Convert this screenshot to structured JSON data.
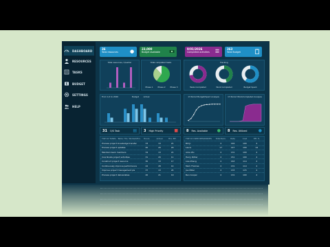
{
  "sidebar": {
    "items": [
      {
        "label": "DASHBOARD",
        "icon": "gauge-icon"
      },
      {
        "label": "RESOURCES",
        "icon": "user-icon"
      },
      {
        "label": "TASKS",
        "icon": "list-icon"
      },
      {
        "label": "BUDGET",
        "icon": "dollar-icon"
      },
      {
        "label": "SETTINGS",
        "icon": "gear-icon"
      },
      {
        "label": "HELP",
        "icon": "help-icon"
      }
    ]
  },
  "kpis": [
    {
      "value": "36",
      "label": "Total resources",
      "color": "#1f8fc6"
    },
    {
      "value": "23,000",
      "label": "Budget available",
      "color": "#20824a"
    },
    {
      "value": "9/01/2026",
      "label": "Completed activities",
      "color": "#8a2b8f"
    },
    {
      "value": "363",
      "label": "Total Budget",
      "color": "#1f8fc6"
    }
  ],
  "panels": {
    "resources_title": "Total resources / Quarter",
    "pie_title": "Total completed tasks",
    "pie_legend": [
      "Phase 1",
      "Phase 2",
      "Phase 3"
    ],
    "pie_values": [
      60,
      28,
      12
    ],
    "tracking_title": "Tracking",
    "donut_labels": [
      "Tasks Completed",
      "Work Completed",
      "Budget Spent"
    ],
    "donut_values": [
      0.72,
      0.45,
      0.6
    ],
    "donut_colors": [
      "#8a2b8f",
      "#20824a",
      "#1f8fc6"
    ],
    "bars_title": "From 1/1 to 2026",
    "bars_legend": [
      "Budget",
      "Actual"
    ],
    "line_title": "13 Period Budget/Spent Analysis",
    "area_title": "13 Period Work/Completed Analysis"
  },
  "stats": [
    {
      "value": "31",
      "label": "O/S Task"
    },
    {
      "value": "3",
      "label": "High Priority"
    },
    {
      "value": "8",
      "label": "Res. Available"
    },
    {
      "value": "8",
      "label": "Res. Utilized"
    }
  ],
  "table_left": {
    "headers": [
      "TOP 10 TASKS - Table: Hrs. Worked/Hrs.",
      "Hours",
      "Actual",
      "Hrs. Eff."
    ],
    "rows": [
      [
        "Process project knowledge transfer",
        "33",
        "13",
        "21"
      ],
      [
        "Process project updates",
        "40",
        "20",
        "20"
      ],
      [
        "Maintain team members",
        "34",
        "13",
        "21"
      ],
      [
        "Coordinate project activities",
        "31",
        "20",
        "11"
      ],
      [
        "Construct project resource",
        "30",
        "13",
        "17"
      ],
      [
        "Continuously improve performance",
        "42",
        "28",
        "14"
      ],
      [
        "Improve project management pls",
        "37",
        "13",
        "24"
      ],
      [
        "Process project deliverables",
        "40",
        "21",
        "19"
      ]
    ]
  },
  "table_right": {
    "headers": [
      "TOP 10 USED RESOURCES",
      "Total Rem.",
      "Rate",
      "Cost",
      "Eff. %"
    ],
    "rows": [
      [
        "Bill Jr.",
        "4",
        "146",
        "100",
        "4"
      ],
      [
        "Laura",
        "17",
        "147",
        "100",
        "14"
      ],
      [
        "Alice Wu",
        "4",
        "131",
        "100",
        "4"
      ],
      [
        "Harry Potter",
        "4",
        "151",
        "100",
        "4"
      ],
      [
        "Lisa Zhang",
        "4",
        "163",
        "114",
        "4"
      ],
      [
        "Mark Thomas",
        "4",
        "131",
        "114",
        "4"
      ],
      [
        "Joe Miller",
        "4",
        "133",
        "115",
        "4"
      ],
      [
        "Ben Cooper",
        "4",
        "131",
        "100",
        "4"
      ]
    ]
  },
  "chart_data": [
    {
      "type": "bar",
      "title": "Total resources / Quarter",
      "categories": [
        "Q1",
        "Q2",
        "Q3",
        "Q4"
      ],
      "values": [
        1,
        4,
        1,
        4
      ]
    },
    {
      "type": "bar",
      "title": "From 1/1 to 2026",
      "categories": [
        "1",
        "2",
        "3",
        "4",
        "5",
        "6",
        "7",
        "8"
      ],
      "series": [
        {
          "name": "Budget",
          "values": [
            2,
            0,
            3,
            4,
            4,
            1,
            2,
            1
          ]
        },
        {
          "name": "Actual",
          "values": [
            1,
            0,
            2,
            3,
            3,
            0,
            1,
            0
          ]
        }
      ]
    },
    {
      "type": "line",
      "title": "13 Period Budget/Spent Analysis",
      "x": [
        1,
        2,
        3,
        4,
        5,
        6,
        7,
        8,
        9,
        10,
        11,
        12,
        13
      ],
      "values": [
        5,
        15,
        35,
        60,
        75,
        82,
        86,
        88,
        89,
        90,
        90,
        90,
        90
      ]
    },
    {
      "type": "area",
      "title": "13 Period Work/Completed Analysis",
      "x": [
        1,
        2,
        3,
        4,
        5,
        6,
        7,
        8,
        9,
        10,
        11,
        12,
        13
      ],
      "values": [
        0,
        0,
        0,
        0,
        2,
        5,
        80,
        85,
        88,
        90,
        90,
        90,
        90
      ]
    }
  ]
}
